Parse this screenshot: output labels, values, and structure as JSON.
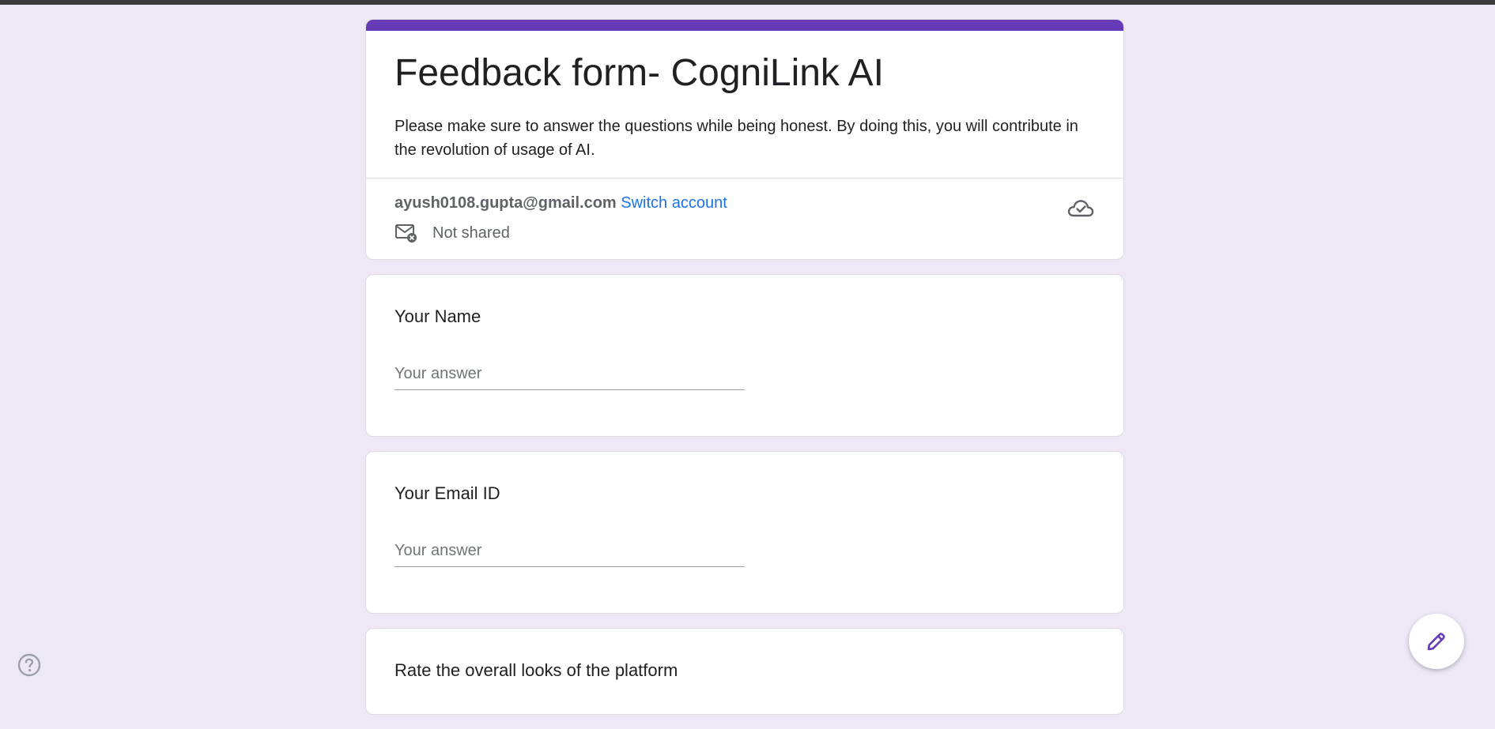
{
  "header": {
    "title": "Feedback form- CogniLink AI",
    "description": "Please make sure to answer the questions while being honest. By doing this, you will contribute in the revolution of usage of AI.",
    "account_email": "ayush0108.gupta@gmail.com",
    "switch_account": "Switch account",
    "email_status": "Not shared"
  },
  "questions": [
    {
      "label": "Your Name",
      "placeholder": "Your answer"
    },
    {
      "label": "Your Email ID",
      "placeholder": "Your answer"
    },
    {
      "label": "Rate the overall looks of the platform"
    }
  ],
  "icons": {
    "cloud": "cloud-check-icon",
    "mail": "mail-not-shared-icon",
    "help": "help-icon",
    "edit": "pencil-icon"
  },
  "colors": {
    "accent": "#673ab7",
    "background": "#ede7f6",
    "link": "#1a73e8"
  }
}
